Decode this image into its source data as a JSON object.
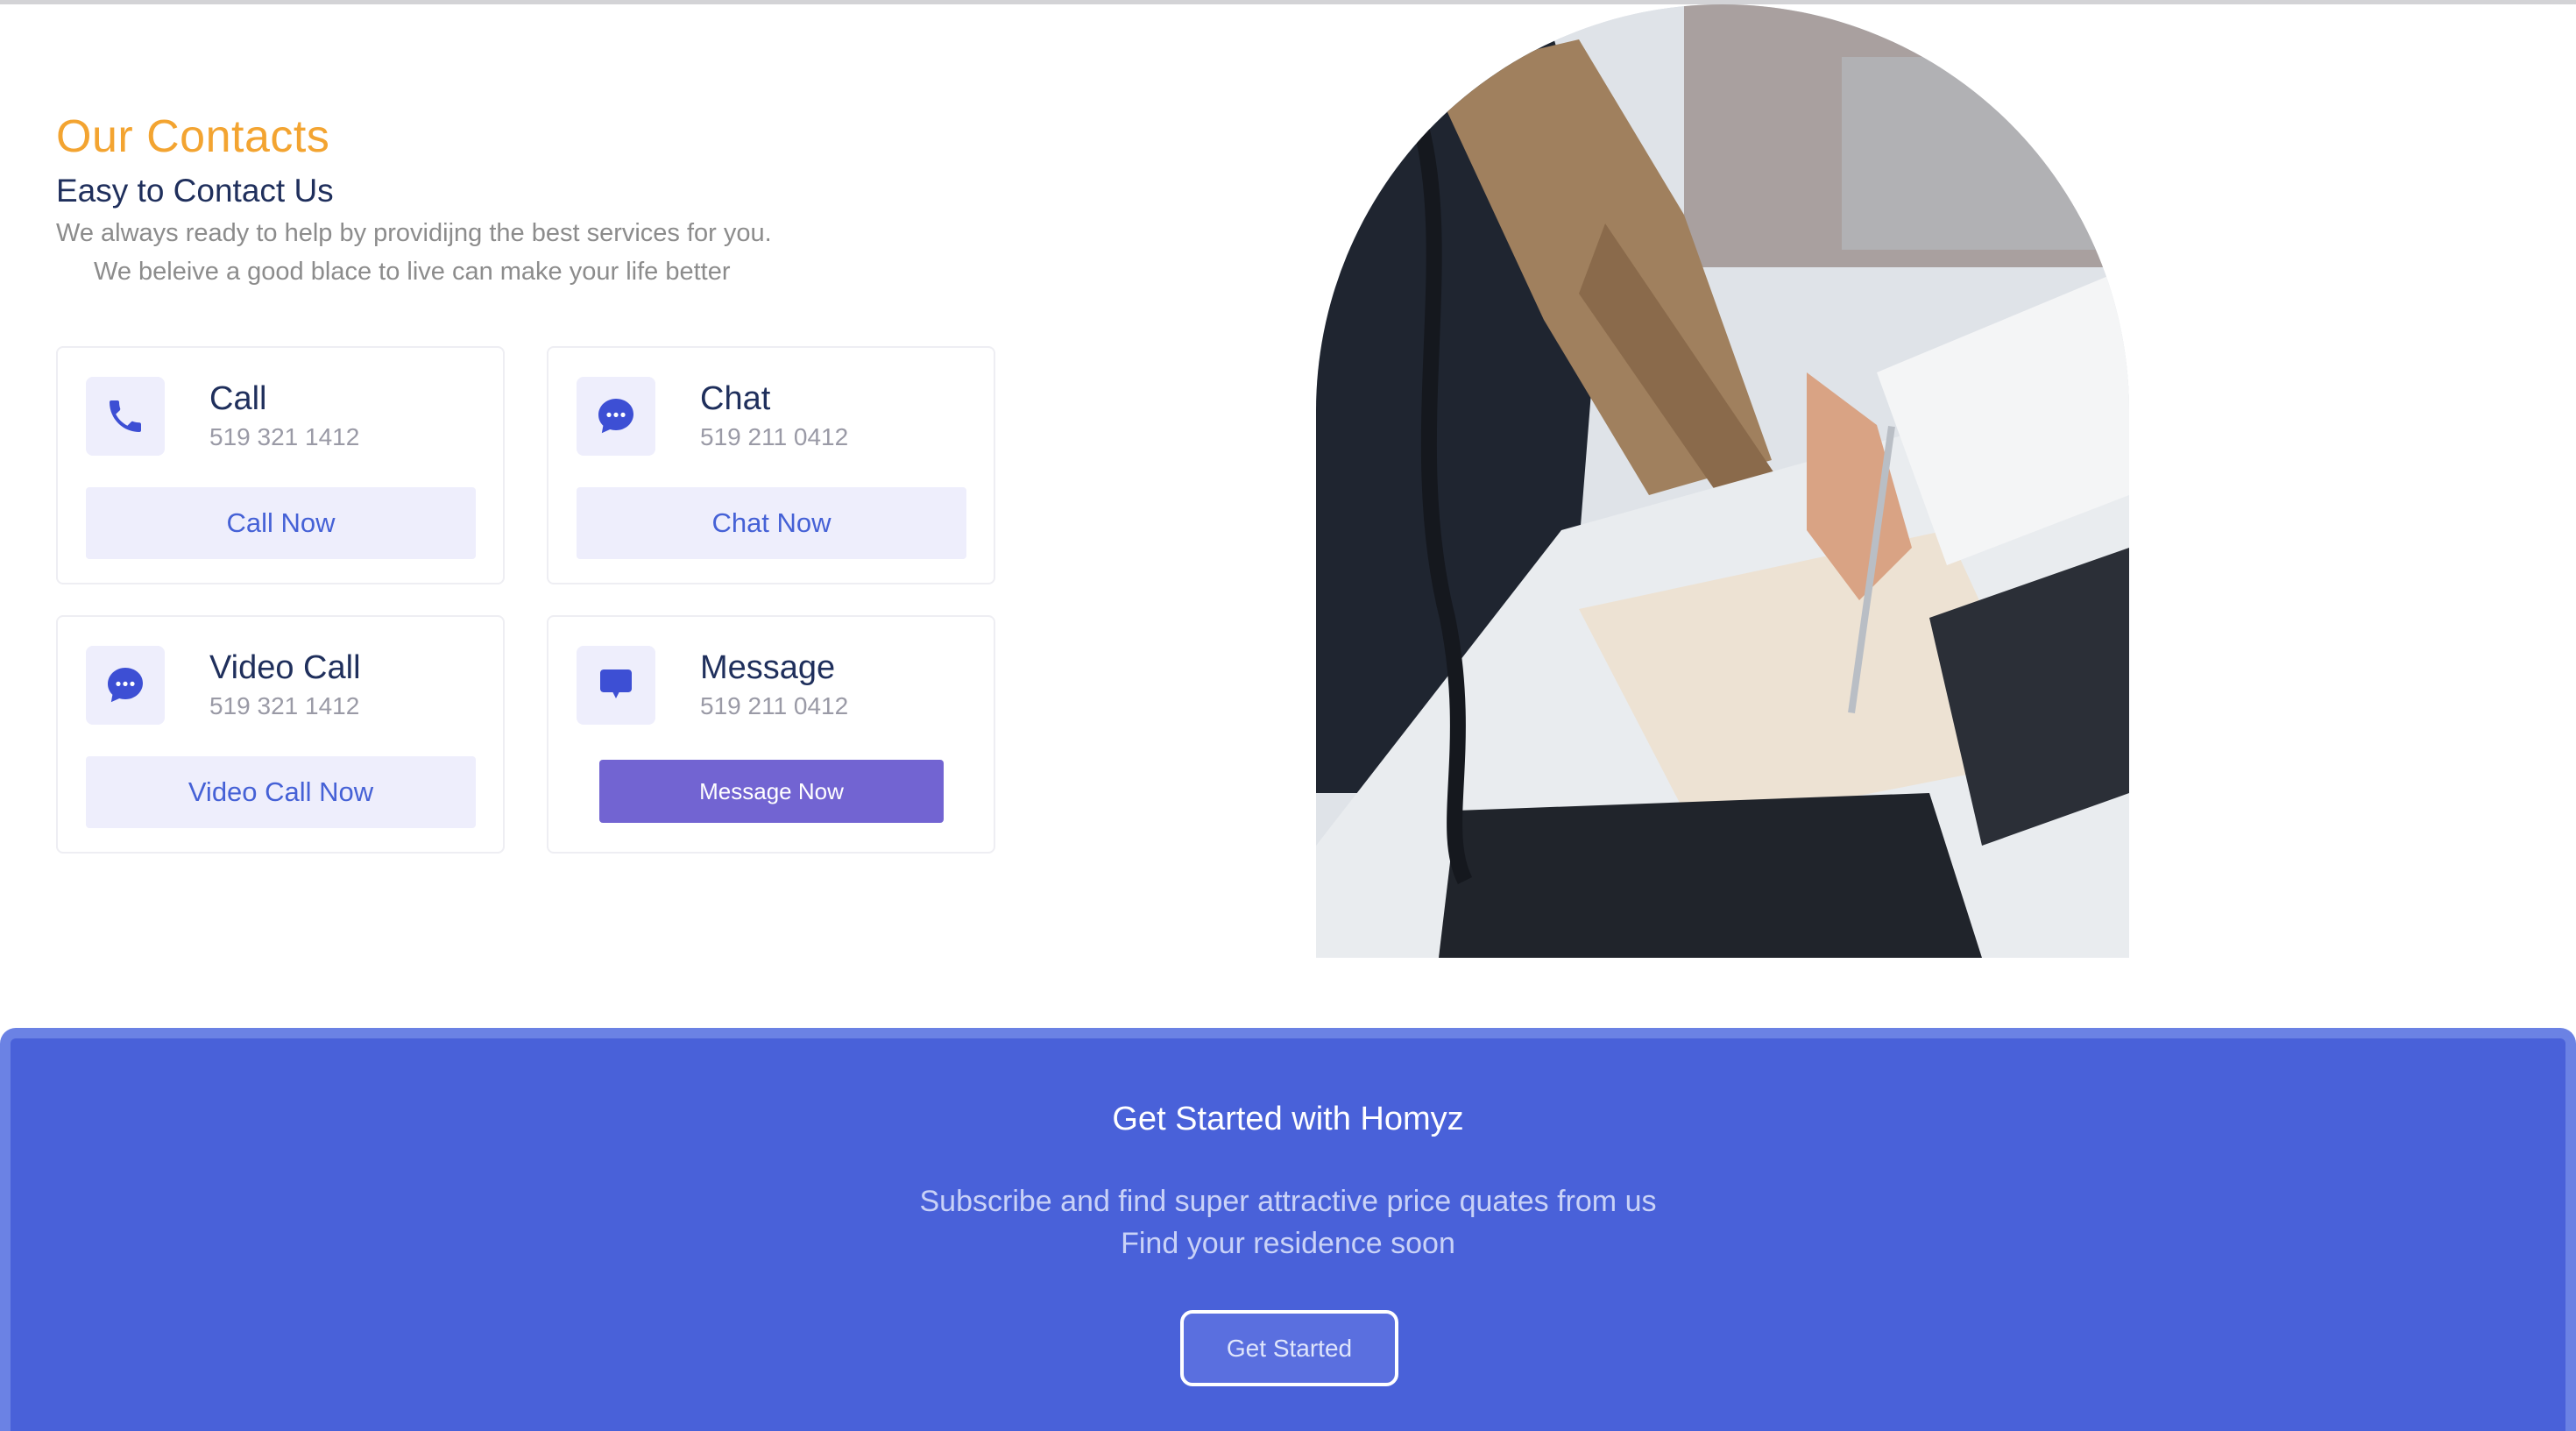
{
  "contacts": {
    "title": "Our Contacts",
    "subtitle": "Easy to Contact Us",
    "description_line1": "We always ready to help by providijng the best services for you.",
    "description_line2": "We beleive a good blace to live can make your life better",
    "cards": [
      {
        "title": "Call",
        "phone": "519 321 1412",
        "button": "Call Now",
        "icon": "phone-icon"
      },
      {
        "title": "Chat",
        "phone": "519 211 0412",
        "button": "Chat Now",
        "icon": "chat-bubble-icon"
      },
      {
        "title": "Video Call",
        "phone": "519 321 1412",
        "button": "Video Call Now",
        "icon": "chat-bubble-icon"
      },
      {
        "title": "Message",
        "phone": "519 211 0412",
        "button": "Message Now",
        "icon": "message-icon"
      }
    ]
  },
  "banner": {
    "title": "Get Started with Homyz",
    "description_line1": "Subscribe and find super attractive price quates from us",
    "description_line2": "Find your residence soon",
    "button": "Get Started"
  },
  "colors": {
    "accent_orange": "#f3a431",
    "navy_text": "#1f2f5c",
    "primary_blue": "#4961d9",
    "button_purple": "#7264d2",
    "soft_lavender": "#eeeefc"
  }
}
